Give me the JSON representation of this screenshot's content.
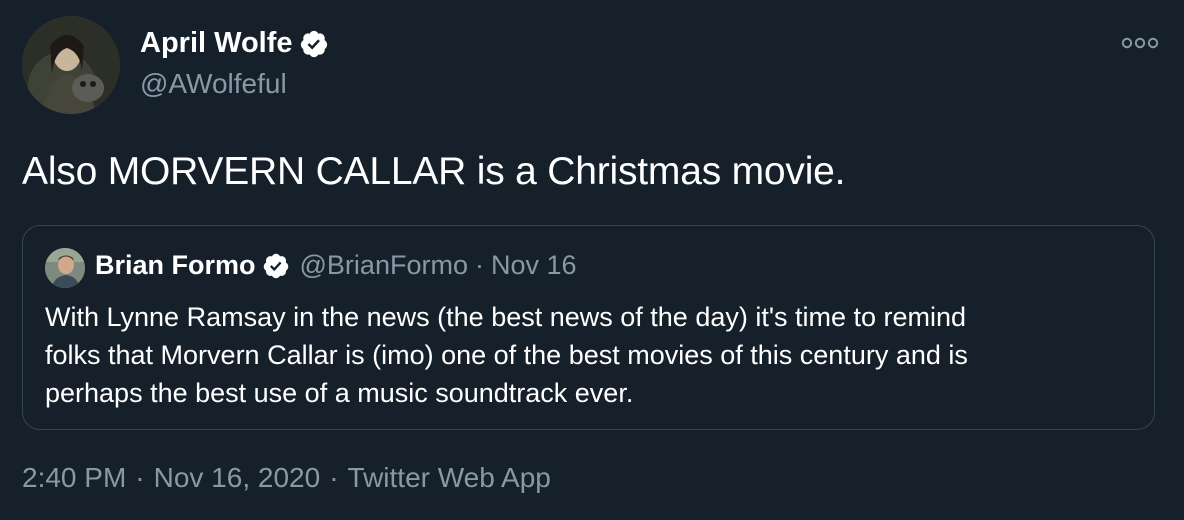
{
  "author": {
    "name": "April Wolfe",
    "handle": "@AWolfeful",
    "verified_icon": "verified-badge-icon"
  },
  "tweet": {
    "text": "Also MORVERN CALLAR is a Christmas movie.",
    "time": "2:40 PM",
    "date": "Nov 16, 2020",
    "separator": "·",
    "source": "Twitter Web App"
  },
  "quoted": {
    "name": "Brian Formo",
    "handle": "@BrianFormo",
    "separator": "·",
    "date": "Nov 16",
    "lines": [
      "With Lynne Ramsay in the news (the best news of the day) it's time to remind",
      "folks that Morvern Callar is (imo) one of the best movies of this century and is",
      "perhaps the best use of a music soundtrack ever."
    ]
  },
  "colors": {
    "background": "#15202b",
    "text_primary": "#ffffff",
    "text_secondary": "#8899a6",
    "border": "#38444d"
  },
  "icons": {
    "more": "more-options-icon"
  }
}
